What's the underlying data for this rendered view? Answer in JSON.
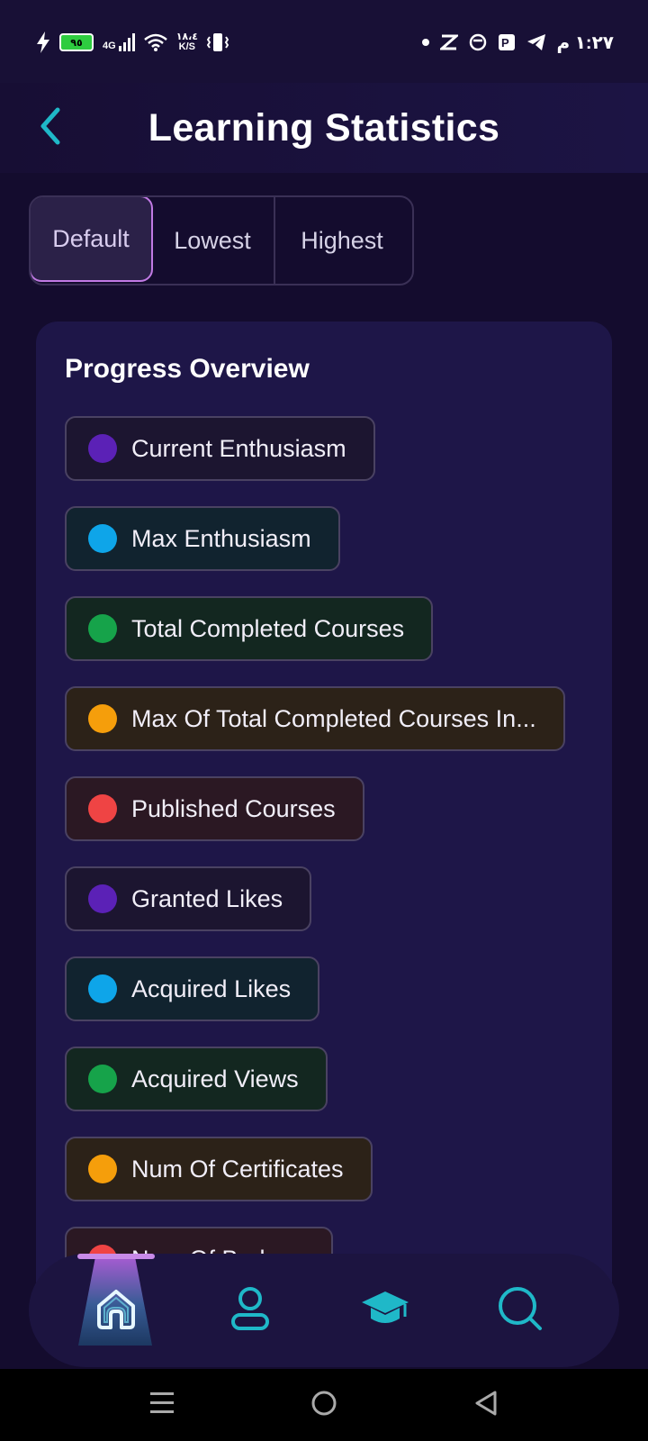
{
  "status_bar": {
    "battery_level": "٩٥",
    "network_type": "4G",
    "data_speed_value": "١٨،٤",
    "data_speed_unit": "K/S",
    "time": "١:٢٧ م"
  },
  "header": {
    "title": "Learning Statistics",
    "back_icon": "chevron-left-icon"
  },
  "sort_tabs": [
    {
      "label": "Default",
      "active": true
    },
    {
      "label": "Lowest",
      "active": false
    },
    {
      "label": "Highest",
      "active": false
    }
  ],
  "card": {
    "title": "Progress Overview",
    "items": [
      {
        "label": "Current Enthusiasm",
        "dot": "#5b21b6",
        "bg": "#1c1530"
      },
      {
        "label": "Max Enthusiasm",
        "dot": "#0ea5e9",
        "bg": "#11232f"
      },
      {
        "label": "Total Completed Courses",
        "dot": "#16a34a",
        "bg": "#132720"
      },
      {
        "label": "Max Of Total Completed Courses In...",
        "dot": "#f59e0b",
        "bg": "#2c2218"
      },
      {
        "label": "Published Courses",
        "dot": "#ef4444",
        "bg": "#2b1823"
      },
      {
        "label": "Granted Likes",
        "dot": "#5b21b6",
        "bg": "#1c1530"
      },
      {
        "label": "Acquired Likes",
        "dot": "#0ea5e9",
        "bg": "#11232f"
      },
      {
        "label": "Acquired Views",
        "dot": "#16a34a",
        "bg": "#132720"
      },
      {
        "label": "Num Of Certificates",
        "dot": "#f59e0b",
        "bg": "#2c2218"
      },
      {
        "label": "Num Of Badges",
        "dot": "#ef4444",
        "bg": "#2b1823"
      }
    ]
  },
  "bottom_nav": [
    {
      "icon": "home-icon",
      "active": true
    },
    {
      "icon": "profile-icon",
      "active": false
    },
    {
      "icon": "graduation-cap-icon",
      "active": false
    },
    {
      "icon": "search-icon",
      "active": false
    }
  ],
  "colors": {
    "accent_cyan": "#1fb8c8",
    "accent_purple": "#c17ae4",
    "background": "#140c2e",
    "card": "#1e1648"
  }
}
